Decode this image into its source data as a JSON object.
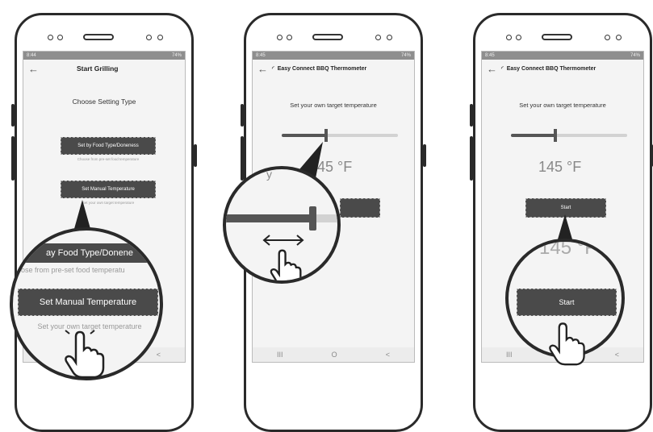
{
  "phones": [
    {
      "status_time": "8:44",
      "status_right": "74%",
      "title": "Start Grilling",
      "heading": "Choose Setting Type",
      "food_button": "Set by Food Type/Doneness",
      "food_caption": "Choose from pre-set food temperature",
      "manual_button": "Set Manual Temperature",
      "manual_caption": "Set your own target temperature",
      "zoom_food_button": "ay Food Type/Donene",
      "zoom_food_caption": "hoose from pre-set food temperatu",
      "zoom_manual_button": "Set Manual Temperature",
      "zoom_manual_caption": "Set your own target temperature"
    },
    {
      "status_time": "8:45",
      "status_right": "74%",
      "title": "Easy Connect BBQ Thermometer",
      "heading": "Set your own target temperature",
      "temperature": "145 °F",
      "slider_fraction": 0.38,
      "zoom_text": "y"
    },
    {
      "status_time": "8:45",
      "status_right": "74%",
      "title": "Easy Connect BBQ Thermometer",
      "heading": "Set your own target temperature",
      "temperature": "145 °F",
      "slider_fraction": 0.38,
      "start_button": "Start",
      "zoom_temperature": "145 °F",
      "zoom_start_button": "Start"
    }
  ],
  "nav": {
    "recent": "III",
    "home": "O",
    "back": "<"
  },
  "icons": [
    "back-arrow-icon",
    "wifi-icon",
    "double-arrow-icon",
    "tap-hand-icon"
  ]
}
